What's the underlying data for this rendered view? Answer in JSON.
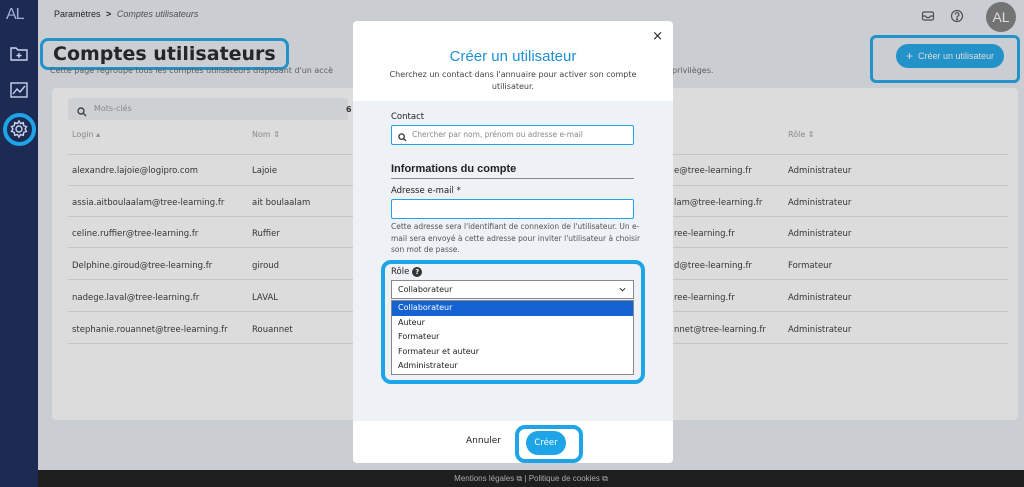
{
  "app": {
    "logo": "AL",
    "avatar_initials": "AL"
  },
  "breadcrumb": {
    "parent": "Paramètres",
    "separator": ">",
    "current": "Comptes utilisateurs"
  },
  "page": {
    "title": "Comptes utilisateurs",
    "description_left": "Cette page regroupe tous les comptes utilisateurs disposant d'un accè",
    "description_right": "privilèges.",
    "create_user_label": "Créer un utilisateur",
    "create_user_plus": "+"
  },
  "table": {
    "search_placeholder": "Mots-clés",
    "result_count": "6",
    "headers": {
      "login": "Login ▴",
      "nom": "Nom ⇕",
      "role": "Rôle ⇕"
    },
    "rows": [
      {
        "login": "alexandre.lajoie@logipro.com",
        "nom": "Lajoie",
        "email_tail": "e@tree-learning.fr",
        "role": "Administrateur"
      },
      {
        "login": "assia.aitboulaalam@tree-learning.fr",
        "nom": "ait boulaalam",
        "email_tail": "lam@tree-learning.fr",
        "role": "Administrateur"
      },
      {
        "login": "celine.ruffier@tree-learning.fr",
        "nom": "Ruffier",
        "email_tail": "ree-learning.fr",
        "role": "Administrateur"
      },
      {
        "login": "Delphine.giroud@tree-learning.fr",
        "nom": "giroud",
        "email_tail": "d@tree-learning.fr",
        "role": "Formateur"
      },
      {
        "login": "nadege.laval@tree-learning.fr",
        "nom": "LAVAL",
        "email_tail": "ree-learning.fr",
        "role": "Administrateur"
      },
      {
        "login": "stephanie.rouannet@tree-learning.fr",
        "nom": "Rouannet",
        "email_tail": "nnet@tree-learning.fr",
        "role": "Administrateur"
      }
    ]
  },
  "modal": {
    "close": "×",
    "title": "Créer un utilisateur",
    "subtitle": "Cherchez un contact dans l'annuaire pour activer son compte utilisateur.",
    "contact_label": "Contact",
    "contact_placeholder": "Chercher par nom, prénom ou adresse e-mail",
    "section_title": "Informations du compte",
    "email_label": "Adresse e-mail *",
    "email_value": "",
    "help_text": "Cette adresse sera l'identifiant de connexion de l'utilisateur. Un e-mail sera envoyé à cette adresse pour inviter l'utilisateur à choisir son mot de passe.",
    "role_label": "Rôle",
    "role_help": "?",
    "role_selected": "Collaborateur",
    "role_options": [
      "Collaborateur",
      "Auteur",
      "Formateur",
      "Formateur et auteur",
      "Administrateur"
    ],
    "cancel_label": "Annuler",
    "create_label": "Créer"
  },
  "footer": {
    "legal": "Mentions légales",
    "separator": "|",
    "cookies": "Politique de cookies"
  }
}
